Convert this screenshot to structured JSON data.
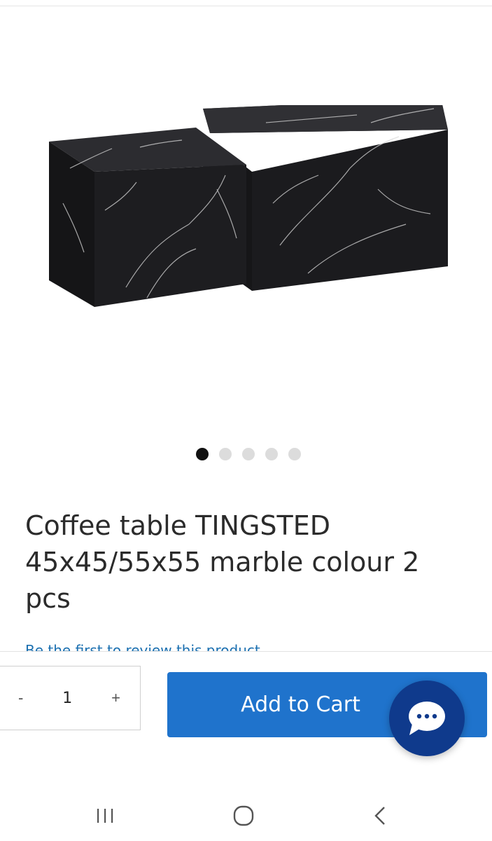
{
  "product": {
    "title": "Coffee table TINGSTED 45x45/55x55 marble colour 2 pcs",
    "image_description_icon": "marble-cube-tables-image",
    "review_prompt": "Be the first to review this product"
  },
  "carousel": {
    "total": 5,
    "active_index": 0
  },
  "cart": {
    "quantity": "1",
    "decrement_label": "-",
    "increment_label": "+",
    "add_to_cart_label": "Add to Cart"
  },
  "colors": {
    "primary_button": "#1f73cc",
    "chat_button": "#0f3a8c",
    "active_dot": "#111111",
    "inactive_dot": "#dcdcdc"
  },
  "icons": {
    "chat": "chat-bubble-icon",
    "nav_recent": "recent-apps-icon",
    "nav_home": "home-icon",
    "nav_back": "back-icon"
  }
}
